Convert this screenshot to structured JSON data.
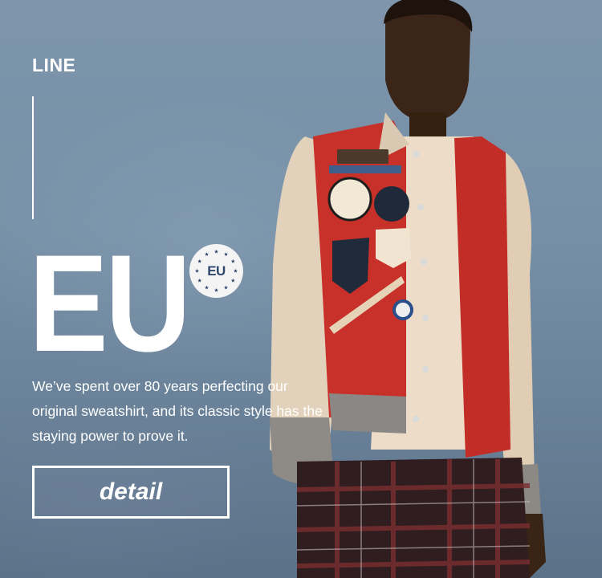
{
  "brand": {
    "name": "LINE"
  },
  "hero": {
    "headline": "EU",
    "badge_label": "EU",
    "description": "We’ve spent over 80 years perfecting our original sweatshirt, and its classic style has the staying power to prove it.",
    "cta_label": "detail"
  },
  "colors": {
    "sky": "#7690a7",
    "jacket_red": "#c8302a",
    "sleeve_cream": "#e6d6c0",
    "badge_text": "#2f4870"
  },
  "icons": {
    "badge": "eu-stars-badge-icon"
  }
}
